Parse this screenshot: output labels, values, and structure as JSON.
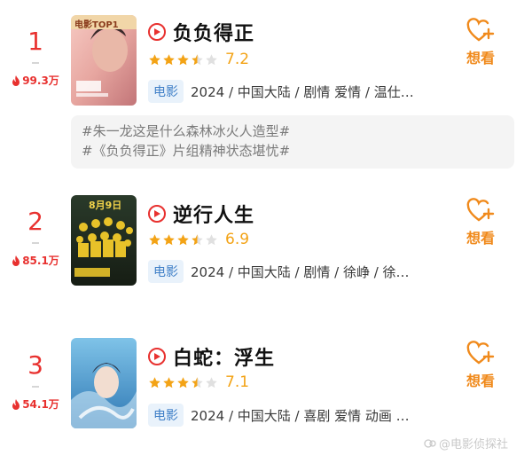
{
  "items": [
    {
      "rank": "1",
      "heat": "99.3万",
      "poster_badge": "电影TOP1",
      "title": "负负得正",
      "score": "7.2",
      "stars_filled": 3.5,
      "tag": "电影",
      "meta": "2024 / 中国大陆 / 剧情 爱情 / 温仕…",
      "want_label": "想看",
      "topics": [
        "#朱一龙这是什么森林冰火人造型#",
        "#《负负得正》片组精神状态堪忧#"
      ]
    },
    {
      "rank": "2",
      "heat": "85.1万",
      "poster_badge": "8月9日",
      "title": "逆行人生",
      "score": "6.9",
      "stars_filled": 3.5,
      "tag": "电影",
      "meta": "2024 / 中国大陆 / 剧情 / 徐峥 / 徐…",
      "want_label": "想看"
    },
    {
      "rank": "3",
      "heat": "54.1万",
      "title": "白蛇：浮生",
      "score": "7.1",
      "stars_filled": 3.5,
      "tag": "电影",
      "meta": "2024 / 中国大陆 / 喜剧 爱情 动画 …",
      "want_label": "想看"
    }
  ],
  "watermark": "@电影侦探社",
  "colors": {
    "rank": "#e8312f",
    "star": "#f3a316",
    "want": "#f08a1c",
    "tag_bg": "#e9f2fb",
    "tag_text": "#3f7fc7"
  }
}
